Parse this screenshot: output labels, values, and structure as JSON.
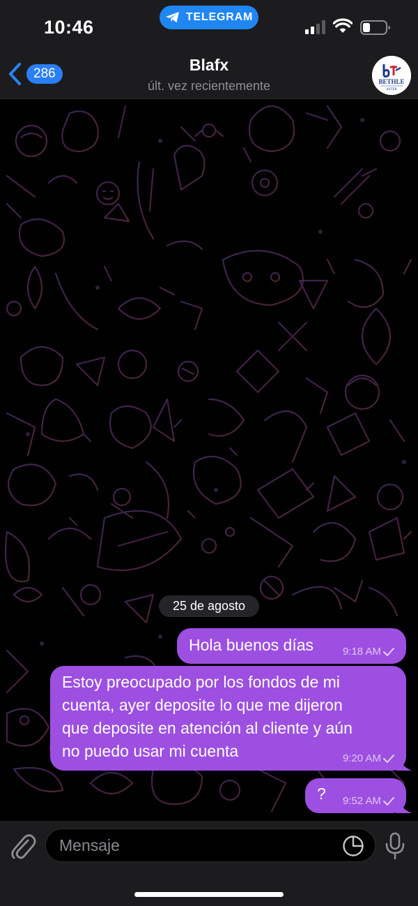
{
  "status_bar": {
    "time": "10:46",
    "app_name": "TELEGRAM",
    "icons": [
      "cellular-signal-icon",
      "wifi-icon",
      "battery-icon"
    ],
    "accent_color": "#1f86f2"
  },
  "header": {
    "unread_count": "286",
    "title": "Blafx",
    "subtitle": "últ. vez recientemente",
    "avatar": {
      "logo_text": "BETHLE",
      "logo_subtext": "ASTER"
    }
  },
  "chat": {
    "date_separator": "25 de agosto",
    "bubble_color": "#9d4fe1",
    "messages": [
      {
        "text": "Hola buenos días",
        "time": "9:18 AM",
        "status": "read"
      },
      {
        "lines": [
          "Estoy preocupado por los fondos de mi",
          "cuenta, ayer deposite lo que me dijeron",
          "que deposite en atención al cliente y aún",
          "no puedo usar mi cuenta"
        ],
        "time": "9:20 AM",
        "status": "read"
      },
      {
        "text": "?",
        "time": "9:52 AM",
        "status": "read"
      }
    ]
  },
  "composer": {
    "placeholder": "Mensaje",
    "icons": [
      "paperclip-icon",
      "sticker-icon",
      "microphone-icon"
    ]
  }
}
